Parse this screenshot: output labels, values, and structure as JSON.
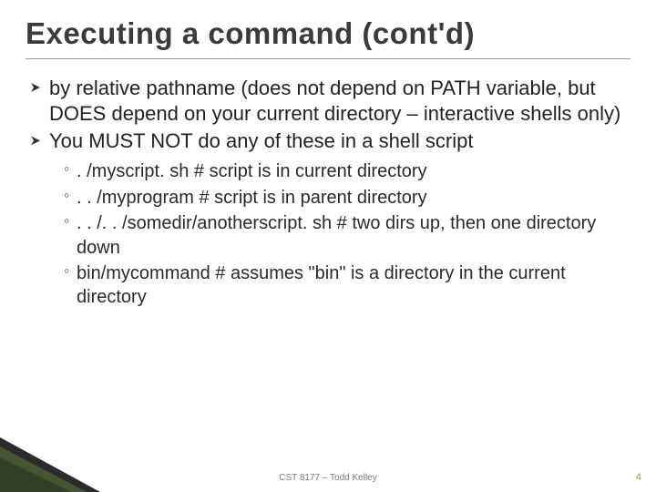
{
  "title": "Executing a command (cont'd)",
  "bullets": {
    "b0": "by relative pathname (does not depend on PATH variable, but DOES depend on your current directory – interactive shells only)",
    "b1": "You MUST NOT do any of these in a shell script"
  },
  "sub": {
    "s0": ". /myscript. sh    # script is in current directory",
    "s1": ". . /myprogram   # script is in parent directory",
    "s2": ". . /. . /somedir/anotherscript. sh # two dirs up, then one directory down",
    "s3": "bin/mycommand  # assumes \"bin\" is a directory in the current directory"
  },
  "footer": "CST 8177 – Todd Kelley",
  "page": "4"
}
